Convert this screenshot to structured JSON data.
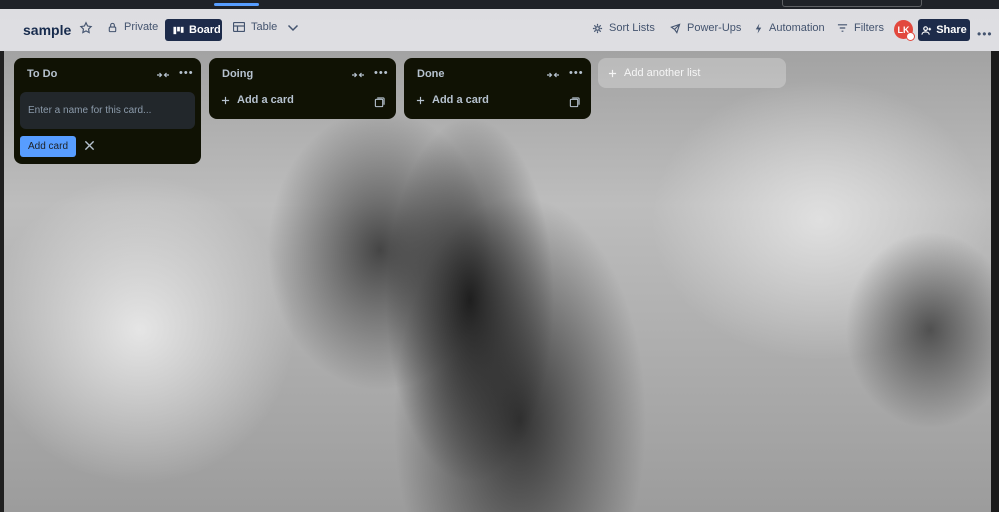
{
  "board": {
    "title": "sample",
    "visibility_label": "Private",
    "views": {
      "board_label": "Board",
      "table_label": "Table"
    },
    "actions": {
      "sort_lists": "Sort Lists",
      "power_ups": "Power-Ups",
      "automation": "Automation",
      "filters": "Filters"
    },
    "member_initials": "LK",
    "share_label": "Share"
  },
  "lists": [
    {
      "title": "To Do",
      "composer": {
        "placeholder": "Enter a name for this card...",
        "add_button": "Add card"
      }
    },
    {
      "title": "Doing",
      "add_card_label": "Add a card"
    },
    {
      "title": "Done",
      "add_card_label": "Add a card"
    }
  ],
  "add_list_label": "Add another list",
  "colors": {
    "list_bg": "#101204",
    "accent": "#579dff",
    "header_btn": "#1d2b4a",
    "avatar": "#e2483d"
  }
}
